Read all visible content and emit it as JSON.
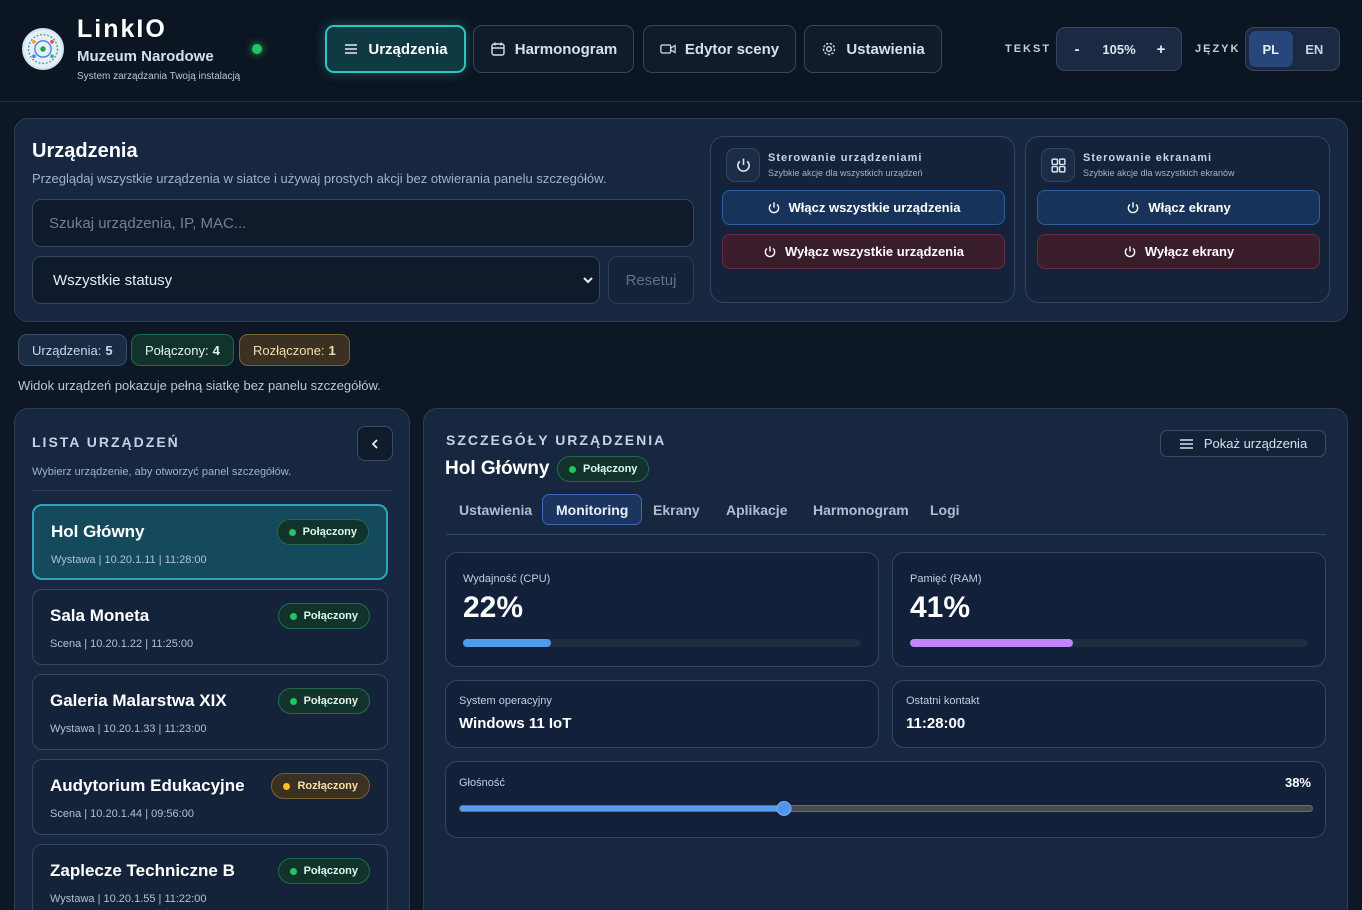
{
  "brand": {
    "title": "LinkIO",
    "subtitle": "Muzeum Narodowe",
    "description": "System zarządzania Twoją instalacją"
  },
  "nav": [
    {
      "label": "Urządzenia",
      "icon": "menu-icon",
      "active": true
    },
    {
      "label": "Harmonogram",
      "icon": "calendar-icon",
      "active": false
    },
    {
      "label": "Edytor sceny",
      "icon": "video-icon",
      "active": false
    },
    {
      "label": "Ustawienia",
      "icon": "gear-icon",
      "active": false
    }
  ],
  "text_size": {
    "caption": "TEKST",
    "minus": "-",
    "value": "105%",
    "plus": "+"
  },
  "language": {
    "caption": "JĘZYK",
    "options": [
      "PL",
      "EN"
    ],
    "selected": "PL"
  },
  "header": {
    "title": "Urządzenia",
    "description": "Przeglądaj wszystkie urządzenia w siatce i używaj prostych akcji bez otwierania panelu szczegółów.",
    "search_placeholder": "Szukaj urządzenia, IP, MAC...",
    "search_value": "",
    "status_filter": "Wszystkie statusy",
    "reset_label": "Resetuj"
  },
  "device_control": {
    "title": "Sterowanie urządzeniami",
    "subtitle": "Szybkie akcje dla wszystkich urządzeń",
    "on_label": "Włącz wszystkie urządzenia",
    "off_label": "Wyłącz wszystkie urządzenia"
  },
  "screen_control": {
    "title": "Sterowanie ekranami",
    "subtitle": "Szybkie akcje dla wszystkich ekranów",
    "on_label": "Włącz ekrany",
    "off_label": "Wyłącz ekrany"
  },
  "stats": [
    {
      "label": "Urządzenia:",
      "value": "5"
    },
    {
      "label": "Połączony:",
      "value": "4"
    },
    {
      "label": "Rozłączone:",
      "value": "1"
    }
  ],
  "note": "Widok urządzeń pokazuje pełną siatkę bez panelu szczegółów.",
  "device_list": {
    "title": "LISTA URZĄDZEŃ",
    "subtitle": "Wybierz urządzenie, aby otworzyć panel szczegółów.",
    "items": [
      {
        "name": "Hol Główny",
        "meta": "Wystawa | 10.20.1.11 | 11:28:00",
        "status": "Połączony",
        "state": "ok",
        "selected": true
      },
      {
        "name": "Sala Moneta",
        "meta": "Scena | 10.20.1.22 | 11:25:00",
        "status": "Połączony",
        "state": "ok",
        "selected": false
      },
      {
        "name": "Galeria Malarstwa XIX",
        "meta": "Wystawa | 10.20.1.33 | 11:23:00",
        "status": "Połączony",
        "state": "ok",
        "selected": false
      },
      {
        "name": "Audytorium Edukacyjne",
        "meta": "Scena | 10.20.1.44 | 09:56:00",
        "status": "Rozłączony",
        "state": "warn",
        "selected": false
      },
      {
        "name": "Zaplecze Techniczne B",
        "meta": "Wystawa | 10.20.1.55 | 11:22:00",
        "status": "Połączony",
        "state": "ok",
        "selected": false
      }
    ]
  },
  "details": {
    "caption": "SZCZEGÓŁY URZĄDZENIA",
    "name": "Hol Główny",
    "status": "Połączony",
    "show_devices_label": "Pokaż urządzenia",
    "tabs": [
      "Ustawienia",
      "Monitoring",
      "Ekrany",
      "Aplikacje",
      "Harmonogram",
      "Logi"
    ],
    "active_tab": "Monitoring",
    "cpu": {
      "label": "Wydajność (CPU)",
      "value": "22%",
      "percent": 22,
      "color": "#4f9bf0"
    },
    "ram": {
      "label": "Pamięć (RAM)",
      "value": "41%",
      "percent": 41,
      "color": "#c084fc"
    },
    "os": {
      "label": "System operacyjny",
      "value": "Windows 11 IoT"
    },
    "last_contact": {
      "label": "Ostatni kontakt",
      "value": "11:28:00"
    },
    "volume": {
      "label": "Głośność",
      "value": "38%",
      "percent": 38
    }
  },
  "colors": {
    "accent": "#2ec4bf",
    "ok": "#22c55e",
    "warn": "#fbbf24",
    "danger": "#6a2b3a"
  }
}
